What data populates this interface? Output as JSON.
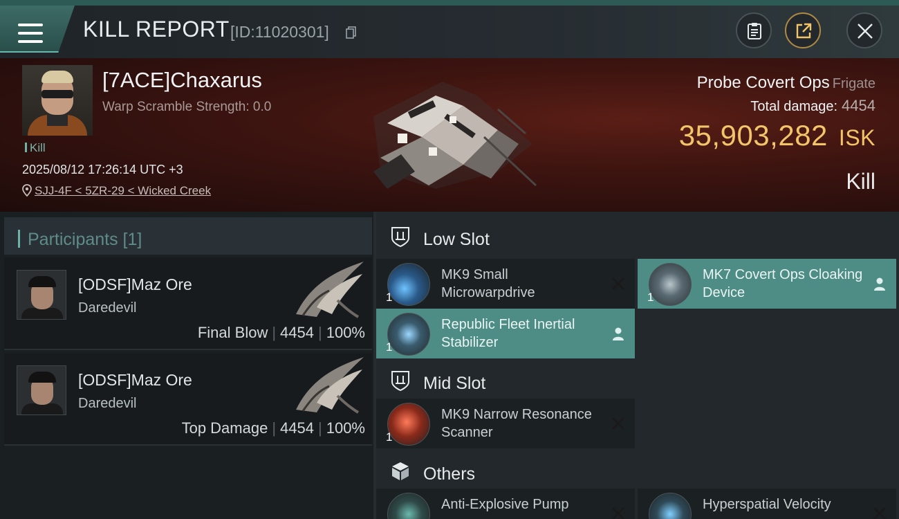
{
  "header": {
    "title": "KILL REPORT",
    "report_id": "[ID:11020301]",
    "buttons": [
      "clipboard-icon",
      "share-icon",
      "close-icon"
    ]
  },
  "victim": {
    "name": "[7ACE]Chaxarus",
    "warp_scramble": "Warp Scramble Strength: 0.0",
    "kill_label": "Kill",
    "timestamp": "2025/08/12 17:26:14 UTC +3",
    "location": "SJJ-4F < 5ZR-29 < Wicked Creek",
    "ship_name": "Probe Covert Ops",
    "ship_class": "Frigate",
    "total_damage_label": "Total damage:",
    "total_damage": "4454",
    "isk_value": "35,903,282",
    "isk_unit": "ISK",
    "outcome": "Kill"
  },
  "participants": {
    "header": "Participants [1]",
    "rows": [
      {
        "name": "[ODSF]Maz Ore",
        "ship": "Daredevil",
        "role": "Final Blow",
        "damage": "4454",
        "percent": "100%"
      },
      {
        "name": "[ODSF]Maz Ore",
        "ship": "Daredevil",
        "role": "Top Damage",
        "damage": "4454",
        "percent": "100%"
      }
    ]
  },
  "slots": {
    "low": {
      "label": "Low Slot",
      "modules": [
        {
          "name": "MK9 Small Microwarpdrive",
          "qty": "1",
          "state": "destroyed",
          "highlight": false
        },
        {
          "name": "MK7 Covert Ops Cloaking Device",
          "qty": "1",
          "state": "dropped",
          "highlight": true
        },
        {
          "name": "Republic Fleet Inertial Stabilizer",
          "qty": "1",
          "state": "dropped",
          "highlight": true
        }
      ]
    },
    "mid": {
      "label": "Mid Slot",
      "modules": [
        {
          "name": "MK9 Narrow Resonance Scanner",
          "qty": "1",
          "state": "destroyed",
          "highlight": false
        }
      ]
    },
    "others": {
      "label": "Others",
      "modules": [
        {
          "name": "Anti-Explosive Pump",
          "qty": "",
          "state": "destroyed",
          "highlight": false
        },
        {
          "name": "Hyperspatial Velocity",
          "qty": "",
          "state": "destroyed",
          "highlight": false
        }
      ]
    }
  },
  "colors": {
    "accent": "#6fb2a7",
    "isk": "#f2c56a",
    "highlight": "#4d8d85",
    "hero_bg": "#3d1410"
  }
}
